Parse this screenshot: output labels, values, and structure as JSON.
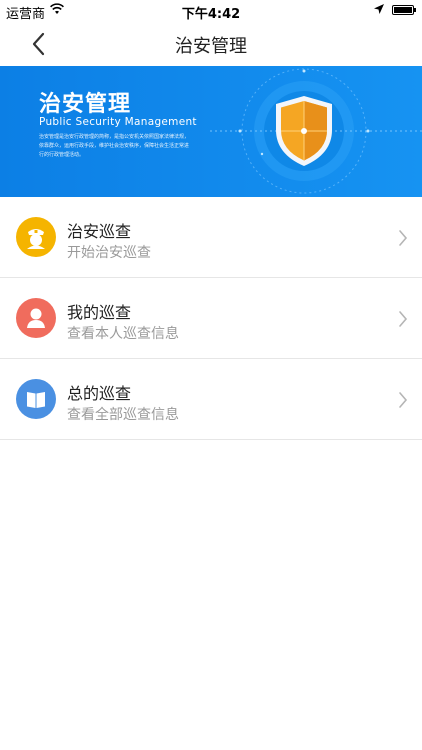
{
  "status_bar": {
    "carrier": "运营商",
    "time": "下午4:42",
    "icons": [
      "wifi-icon",
      "location-arrow-icon",
      "battery-icon"
    ]
  },
  "nav": {
    "title": "治安管理",
    "back_icon": "chevron-left-icon"
  },
  "banner": {
    "title": "治安管理",
    "subtitle": "Public Security Management",
    "description": "治安管理是治安行政管理的简称，是指公安机关依照国家法律法规，依靠群众，运用行政手段，维护社会治安秩序，保障社会生活正常进行的行政管理活动。",
    "icon": "shield-icon",
    "background_color": "#1090ee"
  },
  "menu": [
    {
      "title": "治安巡查",
      "subtitle": "开始治安巡查",
      "icon": "police-officer-icon",
      "color": "#f5b400"
    },
    {
      "title": "我的巡查",
      "subtitle": "查看本人巡查信息",
      "icon": "user-icon",
      "color": "#f06c5d"
    },
    {
      "title": "总的巡查",
      "subtitle": "查看全部巡查信息",
      "icon": "book-icon",
      "color": "#4a90e2"
    }
  ]
}
